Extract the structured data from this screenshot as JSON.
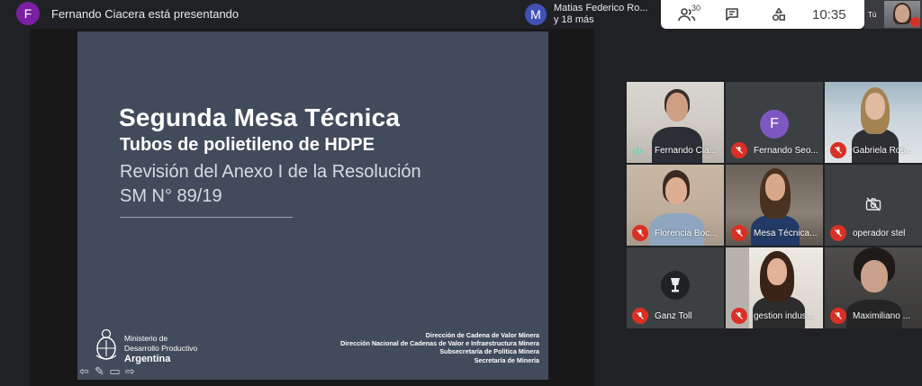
{
  "header": {
    "presenter_initial": "F",
    "presenter_text": "Fernando Ciacera está presentando",
    "speaker_initial": "M",
    "speaker_name": "Matias Federico Ro...",
    "speaker_more": "y 18 más",
    "people_count": "30",
    "clock": "10:35",
    "self_label": "Tú"
  },
  "slide": {
    "title": "Segunda Mesa Técnica",
    "subtitle": "Tubos de polietileno de HDPE",
    "line1": "Revisión del Anexo I de la Resolución",
    "line2": "SM N° 89/19",
    "ministry_line1": "Ministerio de",
    "ministry_line2": "Desarrollo Productivo",
    "ministry_country": "Argentina",
    "credits": [
      "Dirección de Cadena de Valor Minera",
      "Dirección Nacional de Cadenas de Valor e Infraestructura Minera",
      "Subsecretaría de Política Minera",
      "Secretaría de Minería"
    ]
  },
  "participants": [
    {
      "name": "Fernando Cia...",
      "state": "speaking"
    },
    {
      "name": "Fernando Seo...",
      "state": "muted",
      "initial": "F"
    },
    {
      "name": "Gabriela Ros...",
      "state": "muted"
    },
    {
      "name": "Florencia Boc...",
      "state": "muted"
    },
    {
      "name": "Mesa Técnica...",
      "state": "muted"
    },
    {
      "name": "operador stel",
      "state": "muted"
    },
    {
      "name": "Ganz Toll",
      "state": "muted"
    },
    {
      "name": "gestion indus...",
      "state": "muted"
    },
    {
      "name": "Maximiliano ...",
      "state": "muted"
    }
  ],
  "colors": {
    "slide_bg": "#424b5b",
    "app_bg": "#202124",
    "mute_red": "#d93025",
    "speaking_green": "#5edfb5",
    "presenter_avatar": "#7b1fa2",
    "speaker_avatar": "#3f51b5"
  },
  "icons": [
    "people-icon",
    "chat-icon",
    "activities-icon",
    "mic-off-icon",
    "camera-off-icon",
    "trophy-icon",
    "argentina-crest-icon"
  ]
}
